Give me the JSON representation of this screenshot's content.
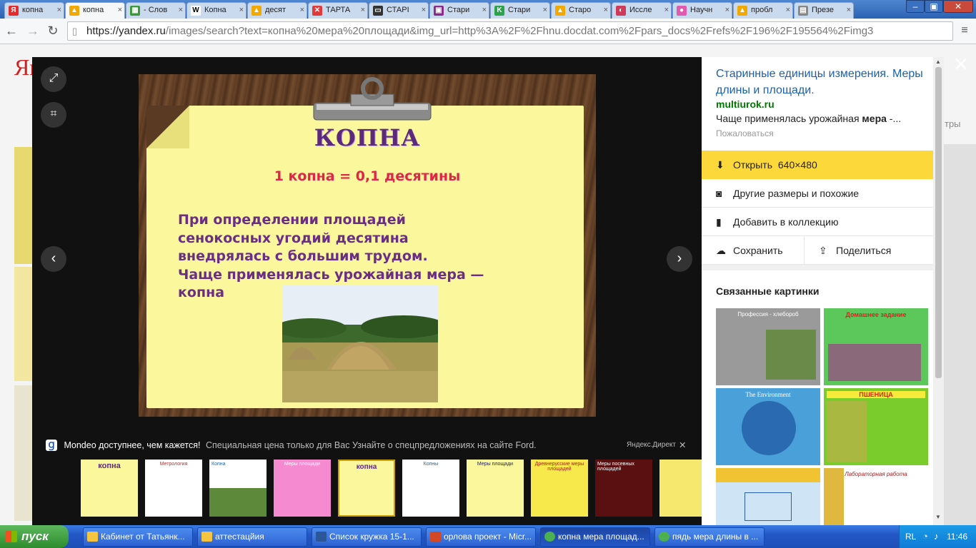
{
  "browser": {
    "tabs": [
      {
        "label": "копна",
        "fav": "Я",
        "color": "#e52b2b"
      },
      {
        "label": "копна",
        "fav": "▲",
        "color": "#f2a800"
      },
      {
        "label": "- Слов",
        "fav": "▦",
        "color": "#3a9a3a"
      },
      {
        "label": "Копна",
        "fav": "W",
        "color": "#ffffff"
      },
      {
        "label": "десят",
        "fav": "▲",
        "color": "#f2a800"
      },
      {
        "label": "ТАРТА",
        "fav": "✕",
        "color": "#e23a3a"
      },
      {
        "label": "СТАРІ",
        "fav": "▭",
        "color": "#333333"
      },
      {
        "label": "Стари",
        "fav": "▣",
        "color": "#8a2a8a"
      },
      {
        "label": "Стари",
        "fav": "K",
        "color": "#2aa34a"
      },
      {
        "label": "Старо",
        "fav": "▲",
        "color": "#f2a800"
      },
      {
        "label": "Иссле",
        "fav": "◐",
        "color": "#d03a5a"
      },
      {
        "label": "Научн",
        "fav": "●",
        "color": "#e05ab0"
      },
      {
        "label": "пробл",
        "fav": "▲",
        "color": "#f2a800"
      },
      {
        "label": "Презе",
        "fav": "▤",
        "color": "#888888"
      }
    ],
    "url_prefix": "https://yandex.ru",
    "url_rest": "/images/search?text=копна%20мера%20площади&img_url=http%3A%2F%2Fhnu.docdat.com%2Fpars_docs%2Frefs%2F196%2F195564%2Fimg3"
  },
  "slide": {
    "title": "КОПНА",
    "formula": "1 копна = 0,1 десятины",
    "body_lines": [
      "При определении площадей",
      "сенокосных угодий десятина",
      "внедрялась с большим трудом.",
      "Чаще применялась урожайная мера —",
      "копна"
    ]
  },
  "ad": {
    "headline": "Mondeo доступнее, чем кажется!",
    "text": "Специальная цена только для Вас Узнайте о спецпредложениях на сайте Ford.",
    "source": "Яндекс.Директ"
  },
  "thumbnails": [
    {
      "label": "копна",
      "bg": "#fbf79c"
    },
    {
      "label": "Метрология",
      "bg": "#ffffff"
    },
    {
      "label": "Копна",
      "bg": "#ffffff"
    },
    {
      "label": "Меры площади",
      "bg": "#f58ad0"
    },
    {
      "label": "копна",
      "bg": "#fbf79c"
    },
    {
      "label": "Копны",
      "bg": "#ffffff"
    },
    {
      "label": "Меры площади",
      "bg": "#fbf79c"
    },
    {
      "label": "Древнерусские меры площадей",
      "bg": "#f7e94c"
    },
    {
      "label": "Меры посевных площадей",
      "bg": "#5a1010"
    },
    {
      "label": "",
      "bg": "#f6e86e"
    }
  ],
  "panel": {
    "title": "Старинные единицы измерения. Меры длины и площади.",
    "site": "multiurok.ru",
    "snippet_pre": "Чаще применялась урожайная ",
    "snippet_bold": "мера",
    "snippet_post": " -...",
    "complain": "Пожаловаться",
    "open_label": "Открыть",
    "open_size": "640×480",
    "other_sizes": "Другие размеры и похожие",
    "add_collection": "Добавить в коллекцию",
    "save": "Сохранить",
    "share": "Поделиться",
    "related_title": "Связанные картинки",
    "related": [
      {
        "title": "Профессия - хлебороб",
        "bg": "#9a9a9a"
      },
      {
        "title": "Домашнее задание",
        "bg": "#5cc85c"
      },
      {
        "title": "The Environment",
        "bg": "#4aa0d8"
      },
      {
        "title": "ПШЕНИЦА",
        "bg": "#7acb2c"
      },
      {
        "title": "",
        "bg": "#cfe4f5"
      },
      {
        "title": "Лабораторная работа",
        "bg": "#ffffff"
      }
    ]
  },
  "background_page": {
    "logo": "Ян",
    "right_text": "тры"
  },
  "taskbar": {
    "start": "пуск",
    "tasks": [
      {
        "label": "Кабинет от Татьянк...",
        "icon": "#f5c542"
      },
      {
        "label": "аттестацйия",
        "icon": "#f5c542"
      },
      {
        "label": "Список кружка 15-1...",
        "icon": "#2b579a"
      },
      {
        "label": "орлова проект - Micr...",
        "icon": "#d24726"
      },
      {
        "label": "копна мера площад...",
        "icon": "#4caf50"
      },
      {
        "label": "пядь мера длины в ...",
        "icon": "#4caf50"
      }
    ],
    "lang": "RL",
    "time": "11:46"
  }
}
